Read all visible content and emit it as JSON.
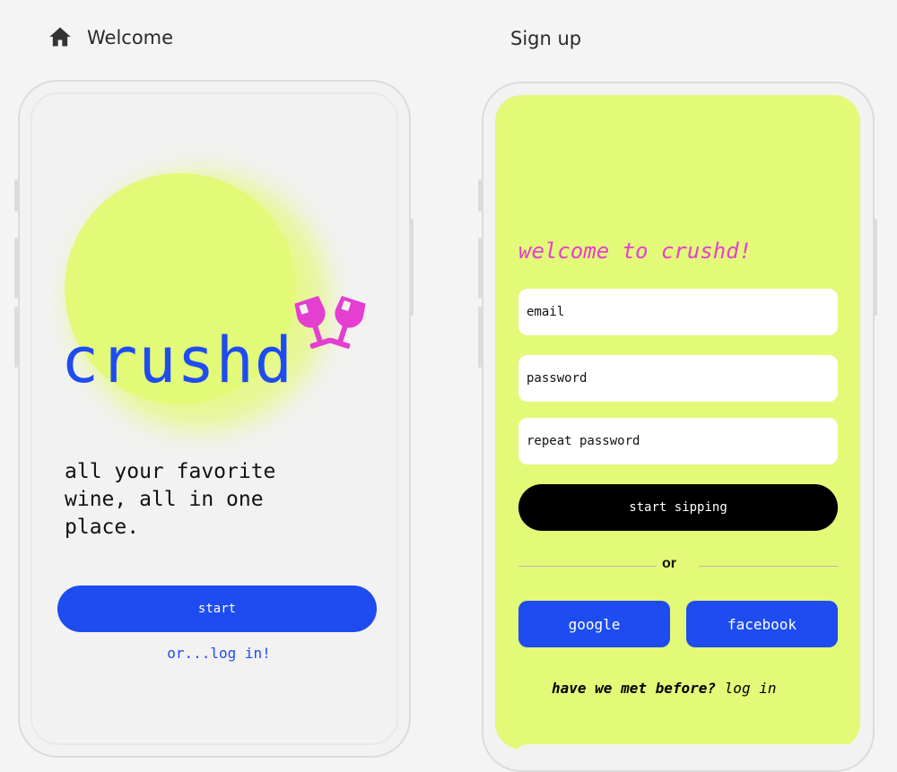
{
  "frames": {
    "left_label": "Welcome",
    "right_label": "Sign up"
  },
  "colors": {
    "brand_blue": "#1e4cf0",
    "lime": "#e3f978",
    "magenta": "#e43fd0",
    "black": "#000000"
  },
  "welcome_screen": {
    "logo": "crushd",
    "logo_icon": "wine-glasses-cheers-icon",
    "tagline": "all your favorite wine, all in one place.",
    "start_label": "start",
    "login_link": "or...log in!"
  },
  "signup_screen": {
    "heading": "welcome to crushd!",
    "email_placeholder": "email",
    "password_placeholder": "password",
    "repeat_password_placeholder": "repeat password",
    "submit_label": "start sipping",
    "divider_label": "or",
    "google_label": "google",
    "facebook_label": "facebook",
    "met_before_label": "have we met before?",
    "login_label": "log in"
  }
}
